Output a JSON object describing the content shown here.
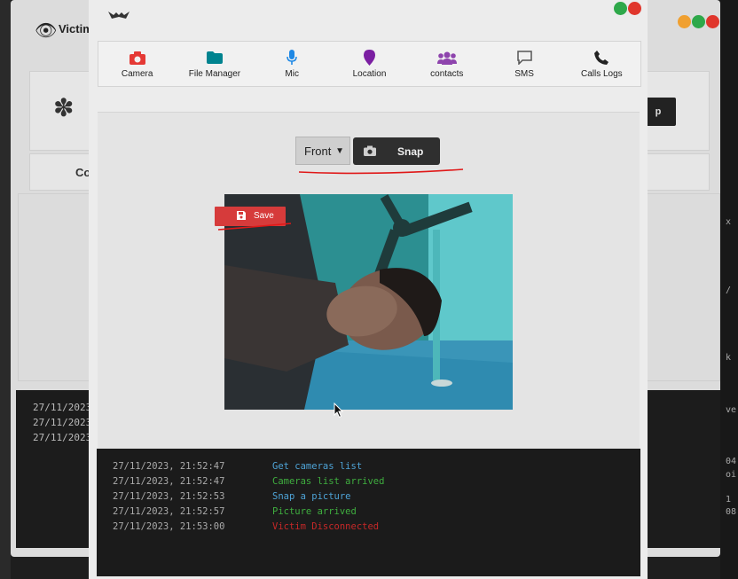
{
  "background": {
    "title": "Victim",
    "left_button_text": "Co",
    "right_button_text": "p",
    "log_timestamps": [
      "27/11/2023",
      "27/11/2023",
      "27/11/2023"
    ],
    "right_strip_text": [
      "x",
      "/",
      "k",
      "ve",
      "04",
      "oi",
      "1",
      "08"
    ]
  },
  "nav": {
    "items": [
      {
        "label": "Camera",
        "icon": "camera-icon",
        "color": "#e53935"
      },
      {
        "label": "File Manager",
        "icon": "folder-icon",
        "color": "#00838f"
      },
      {
        "label": "Mic",
        "icon": "mic-icon",
        "color": "#1e88e5"
      },
      {
        "label": "Location",
        "icon": "map-marker-icon",
        "color": "#7b1fa2"
      },
      {
        "label": "contacts",
        "icon": "users-icon",
        "color": "#8e44ad"
      },
      {
        "label": "SMS",
        "icon": "message-icon",
        "color": "#555555"
      },
      {
        "label": "Calls Logs",
        "icon": "phone-icon",
        "color": "#222222"
      }
    ]
  },
  "camera": {
    "selected": "Front",
    "snap_label": "Snap",
    "save_label": "Save"
  },
  "log": [
    {
      "time": "27/11/2023, 21:52:47",
      "message": "Get cameras list",
      "color": "#4ea3d6"
    },
    {
      "time": "27/11/2023, 21:52:47",
      "message": "Cameras list arrived",
      "color": "#3fae3f"
    },
    {
      "time": "27/11/2023, 21:52:53",
      "message": "Snap a picture",
      "color": "#4ea3d6"
    },
    {
      "time": "27/11/2023, 21:52:57",
      "message": "Picture arrived",
      "color": "#3fae3f"
    },
    {
      "time": "27/11/2023, 21:53:00",
      "message": "Victim Disconnected",
      "color": "#c62828"
    }
  ],
  "window_dots": [
    "#f0a030",
    "#2ea84a",
    "#e0362c"
  ]
}
